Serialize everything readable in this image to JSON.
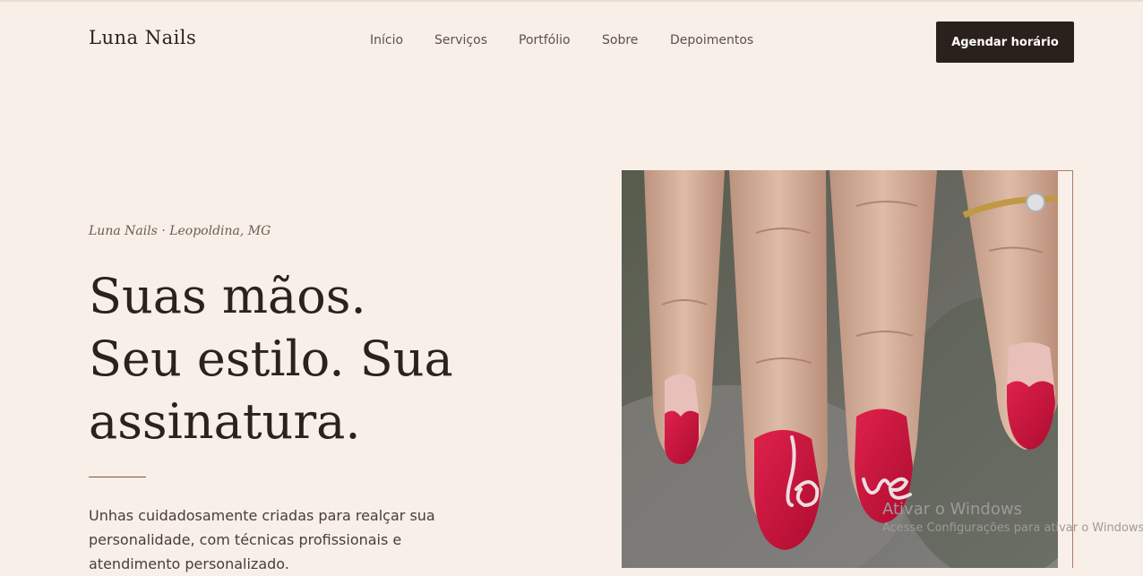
{
  "brand": {
    "name": "Luna Nails"
  },
  "nav": {
    "items": [
      "Início",
      "Serviços",
      "Portfólio",
      "Sobre",
      "Depoimentos"
    ]
  },
  "header": {
    "cta_label": "Agendar horário"
  },
  "hero": {
    "eyebrow": "Luna Nails · Leopoldina, MG",
    "headline_lines": [
      "Suas mãos.",
      "Seu estilo. Sua",
      "assinatura."
    ],
    "description": "Unhas cuidadosamente criadas para realçar sua personalidade, com técnicas profissionais e atendimento personalizado.",
    "image_nail_text": "love"
  },
  "colors": {
    "background": "#f7efe8",
    "accent_dark": "#2a201c",
    "accent_line": "#8a4f3f",
    "nail_red": "#d4123e"
  },
  "os_overlay": {
    "line1": "Ativar o Windows",
    "line2": "Acesse Configurações para ativar o Windows."
  }
}
